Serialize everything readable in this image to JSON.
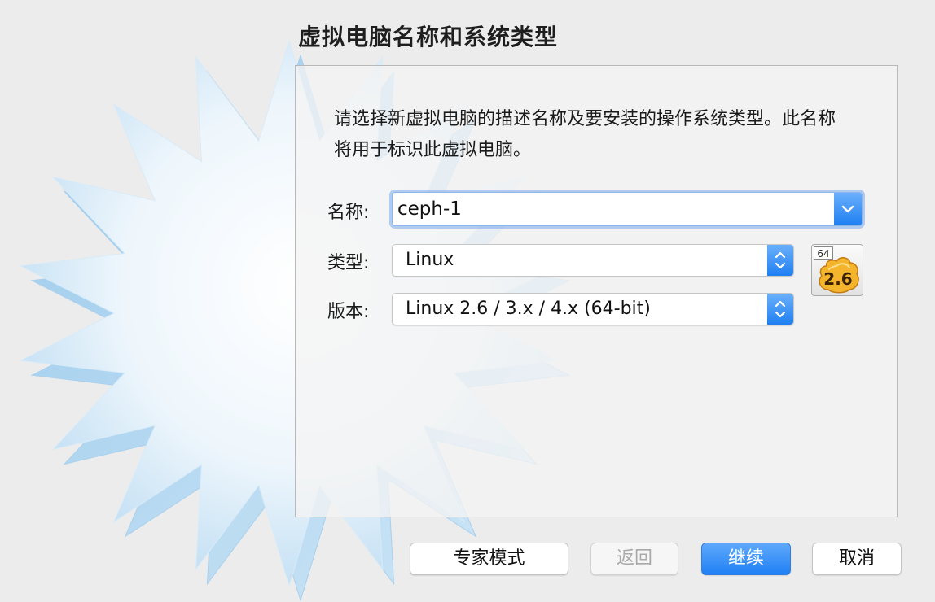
{
  "dialog": {
    "title": "虚拟电脑名称和系统类型",
    "description": "请选择新虚拟电脑的描述名称及要安装的操作系统类型。此名称将用于标识此虚拟电脑。"
  },
  "form": {
    "name_label": "名称:",
    "name_value": "ceph-1",
    "type_label": "类型:",
    "type_value": "Linux",
    "version_label": "版本:",
    "version_value": "Linux 2.6 / 3.x / 4.x (64-bit)"
  },
  "os_icon": {
    "bits": "64",
    "version": "2.6",
    "icon": "linux-2.6-icon"
  },
  "buttons": {
    "expert": "专家模式",
    "back": "返回",
    "continue": "继续",
    "cancel": "取消"
  },
  "colors": {
    "accent": "#1f80f4",
    "background": "#ececec",
    "starburst": "#c6e1f3"
  }
}
